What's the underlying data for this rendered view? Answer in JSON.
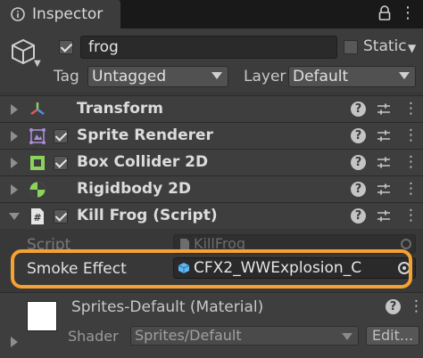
{
  "tab": {
    "title": "Inspector"
  },
  "header": {
    "object_active": true,
    "object_name": "frog",
    "static_label": "Static",
    "static_checked": false,
    "tag_label": "Tag",
    "tag_value": "Untagged",
    "layer_label": "Layer",
    "layer_value": "Default"
  },
  "components": [
    {
      "title": "Transform",
      "icon": "transform-icon",
      "has_checkbox": false,
      "expanded": false
    },
    {
      "title": "Sprite Renderer",
      "icon": "sprite-renderer-icon",
      "has_checkbox": true,
      "enabled": true,
      "expanded": false
    },
    {
      "title": "Box Collider 2D",
      "icon": "box-collider-icon",
      "has_checkbox": true,
      "enabled": true,
      "expanded": false
    },
    {
      "title": "Rigidbody 2D",
      "icon": "rigidbody-icon",
      "has_checkbox": false,
      "expanded": false
    },
    {
      "title": "Kill Frog (Script)",
      "icon": "script-icon",
      "has_checkbox": true,
      "enabled": true,
      "expanded": true
    }
  ],
  "script_fields": {
    "script_label": "Script",
    "script_value": "KillFrog",
    "smoke_label": "Smoke Effect",
    "smoke_value": "CFX2_WWExplosion_C"
  },
  "material": {
    "name": "Sprites-Default (Material)",
    "shader_label": "Shader",
    "shader_value": "Sprites/Default",
    "edit_label": "Edit..."
  },
  "colors": {
    "highlight": "#f5a133",
    "panel": "#3e3e3e",
    "background": "#383838"
  }
}
